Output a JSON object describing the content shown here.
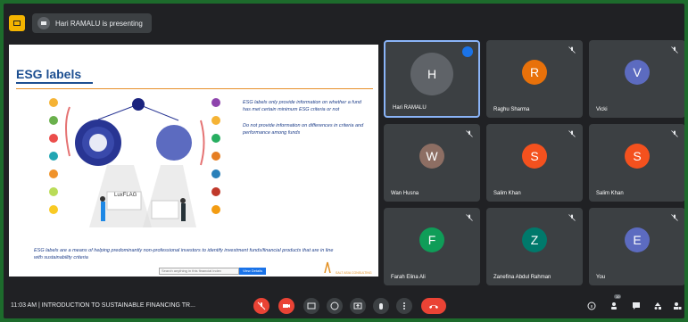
{
  "topbar": {
    "presenter_text": "Hari RAMALU is presenting"
  },
  "slide": {
    "title": "ESG labels",
    "side_text_1": "ESG labels only provide information on whether a fund has met certain minimum ESG criteria or not",
    "side_text_2": "Do not provide information on differences in criteria and performance among funds",
    "bottom_text": "ESG labels are a means of helping predominantly non-professional investors to identify investment funds/financial products that are in line with sustainability criteria",
    "search_placeholder": "Search anything in this financial index",
    "search_button": "View Details",
    "luxflag": "LuxFLAG",
    "logo_text": "SALT ASIA CONSULTING"
  },
  "participants": [
    {
      "name": "Hari RAMALU",
      "initial": "H",
      "color": "#5f6368",
      "speaking": true
    },
    {
      "name": "Raghu Sharma",
      "initial": "R",
      "color": "#e8710a",
      "speaking": false
    },
    {
      "name": "Vicki",
      "initial": "V",
      "color": "#5c6bc0",
      "speaking": false
    },
    {
      "name": "Wan Husna",
      "initial": "W",
      "color": "#8d6e63",
      "speaking": false
    },
    {
      "name": "Salim Khan",
      "initial": "S",
      "color": "#f4511e",
      "speaking": false
    },
    {
      "name": "Salim Khan",
      "initial": "S",
      "color": "#f4511e",
      "speaking": false
    },
    {
      "name": "Farah Elina Ali",
      "initial": "F",
      "color": "#0f9d58",
      "speaking": false
    },
    {
      "name": "Zanefina Abdul Rahman",
      "initial": "Z",
      "color": "#00796b",
      "speaking": false
    },
    {
      "name": "You",
      "initial": "E",
      "color": "#5c6bc0",
      "speaking": false
    }
  ],
  "bottombar": {
    "time_title": "11:03 AM  |  INTRODUCTION TO SUSTAINABLE FINANCING TR...",
    "participants_count": "10"
  },
  "colors": {
    "frame": "#1d6b2c",
    "app_bg": "#202124",
    "tile_bg": "#3c4043",
    "accent_blue": "#8ab4f8",
    "red": "#ea4335"
  }
}
